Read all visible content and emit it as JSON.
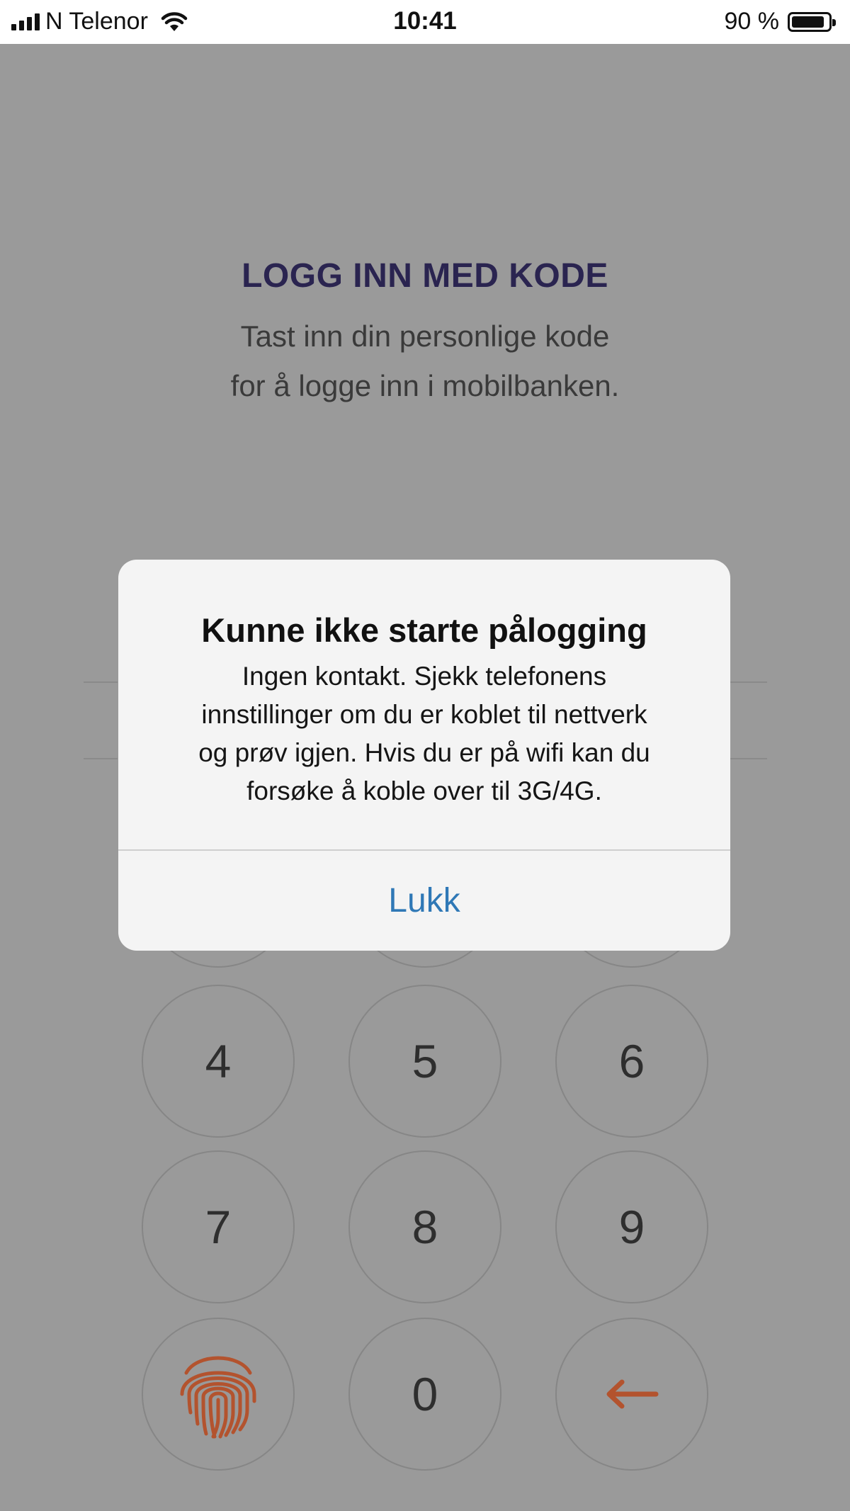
{
  "status_bar": {
    "carrier": "N Telenor",
    "time": "10:41",
    "battery": "90 %",
    "battery_level": 0.9,
    "signal_icon": "signal-bars-icon",
    "wifi_icon": "wifi-icon",
    "battery_icon": "battery-icon"
  },
  "login": {
    "title": "LOGG INN MED KODE",
    "subtitle_line1": "Tast inn din personlige kode",
    "subtitle_line2": "for å logge inn i mobilbanken."
  },
  "keypad": {
    "keys": [
      "4",
      "5",
      "6",
      "7",
      "8",
      "9",
      "0"
    ],
    "fingerprint_icon": "fingerprint-icon",
    "backspace_icon": "backspace-arrow-icon",
    "accent_color": "#b3532e"
  },
  "dialog": {
    "title": "Kunne ikke starte pålogging",
    "message_lines": [
      "Ingen kontakt. Sjekk telefonens",
      "innstillinger om du er koblet til nettverk",
      "og prøv igjen. Hvis du er på wifi kan du",
      "forsøke å koble over til 3G/4G."
    ],
    "button": "Lukk",
    "button_color": "#2f78b6"
  }
}
